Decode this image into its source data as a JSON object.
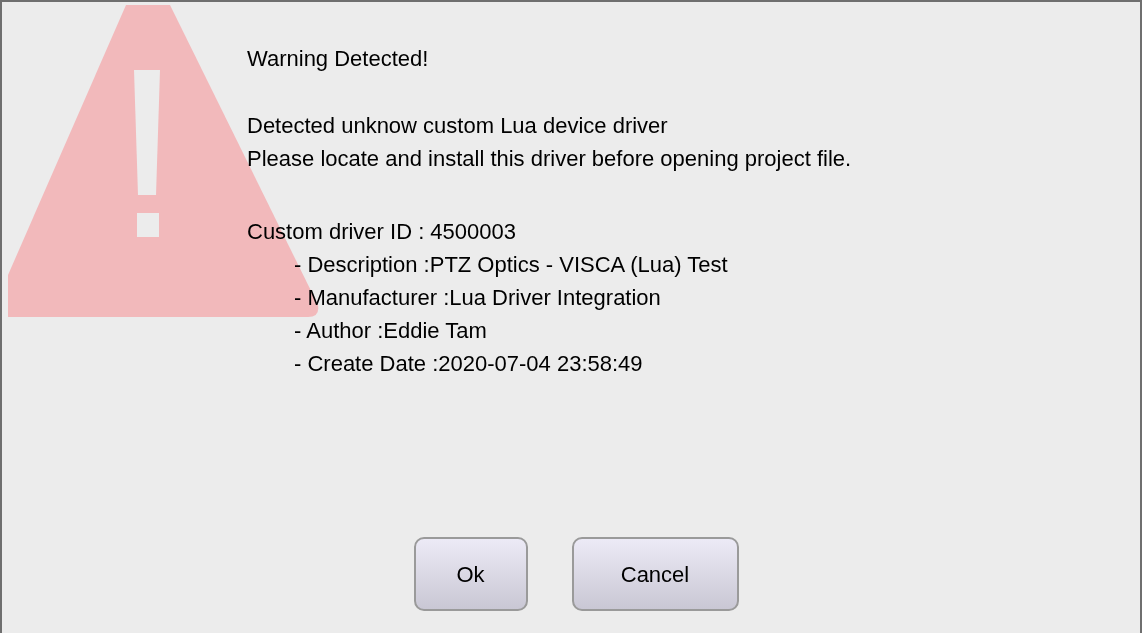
{
  "title": "Warning Detected!",
  "message": [
    "Detected unknow custom Lua device driver",
    "Please locate and install this driver before opening project file."
  ],
  "driver_id": "Custom driver ID : 4500003",
  "details": [
    "- Description :PTZ Optics - VISCA (Lua) Test",
    "- Manufacturer :Lua Driver Integration",
    "- Author :Eddie Tam",
    "- Create Date :2020-07-04 23:58:49"
  ],
  "buttons": [
    "Ok",
    "Cancel"
  ]
}
